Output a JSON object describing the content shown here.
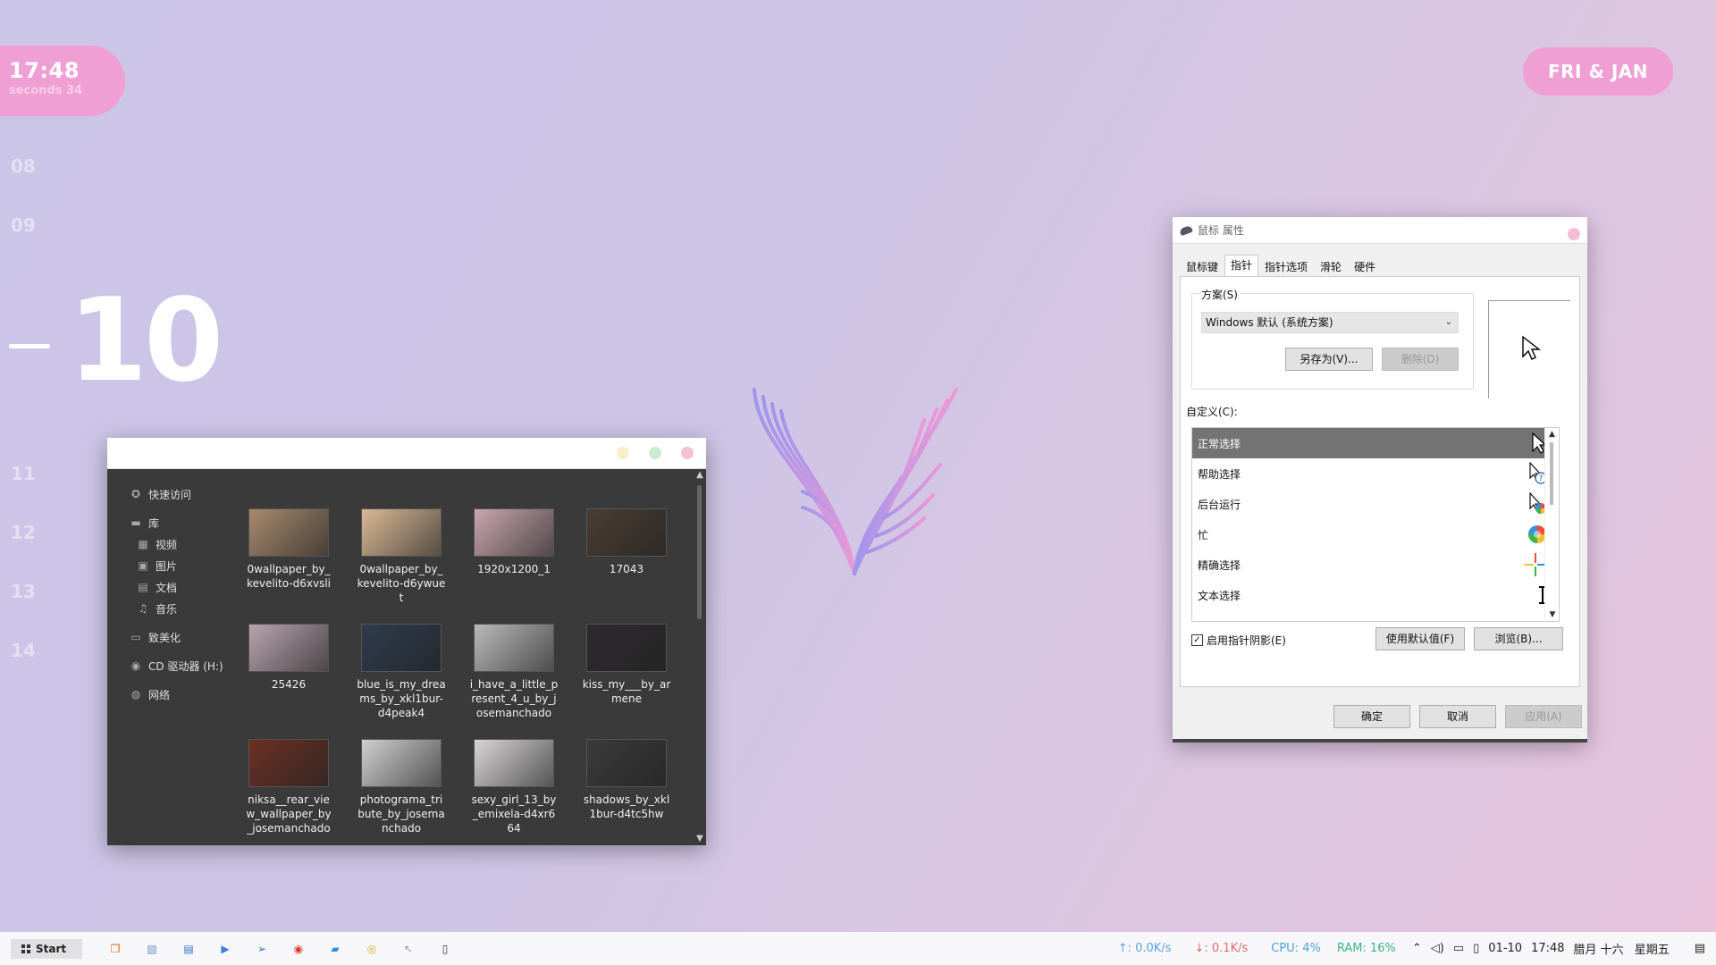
{
  "clock": {
    "time": "17:48",
    "seconds": "seconds 34"
  },
  "date": {
    "label": "FRI & JAN"
  },
  "hours": {
    "h08": "08",
    "h09": "09",
    "current": "10",
    "h11": "11",
    "h12": "12",
    "h13": "13",
    "h14": "14"
  },
  "explorer": {
    "nav": {
      "quick_access": "快速访问",
      "library": "库",
      "videos": "视频",
      "pictures": "图片",
      "documents": "文档",
      "music": "音乐",
      "beautify": "致美化",
      "cd_drive": "CD 驱动器 (H:)",
      "network": "网络"
    },
    "files": [
      {
        "name": "0wallpaper_by_kevelito-d6xvsli",
        "color": "#a88a6e"
      },
      {
        "name": "0wallpaper_by_kevelito-d6ywuet",
        "color": "#d9b996"
      },
      {
        "name": "1920x1200_1",
        "color": "#c9a6ad"
      },
      {
        "name": "17043",
        "color": "#4a3d33"
      },
      {
        "name": "25426",
        "color": "#b7a4ad"
      },
      {
        "name": "blue_is_my_dreams_by_xkl1bur-d4peak4",
        "color": "#2e3b4d"
      },
      {
        "name": "i_have_a_little_present_4_u_by_josemanchado",
        "color": "#b9b9b9"
      },
      {
        "name": "kiss_my___by_armene",
        "color": "#2d2a2d"
      },
      {
        "name": "niksa__rear_view_wallpaper_by_josemanchado",
        "color": "#6a3024"
      },
      {
        "name": "photograma_tribute_by_josemanchado",
        "color": "#cfcfcf"
      },
      {
        "name": "sexy_girl_13_by_emixela-d4xr664",
        "color": "#d8d5d7"
      },
      {
        "name": "shadows_by_xkl1bur-d4tc5hw",
        "color": "#3a3a3a"
      }
    ]
  },
  "dialog": {
    "title": "鼠标 属性",
    "tabs": [
      "鼠标键",
      "指针",
      "指针选项",
      "滑轮",
      "硬件"
    ],
    "active_tab": "指针",
    "scheme_label": "方案(S)",
    "scheme_value": "Windows 默认 (系统方案)",
    "save_as": "另存为(V)...",
    "delete": "删除(D)",
    "customize_label": "自定义(C):",
    "cursors": [
      {
        "label": "正常选择",
        "icon": "arrow-cursor-icon",
        "glyph": "➤"
      },
      {
        "label": "帮助选择",
        "icon": "help-cursor-icon",
        "glyph": "?"
      },
      {
        "label": "后台运行",
        "icon": "working-cursor-icon",
        "glyph": "◔"
      },
      {
        "label": "忙",
        "icon": "busy-cursor-icon",
        "glyph": "●"
      },
      {
        "label": "精确选择",
        "icon": "crosshair-cursor-icon",
        "glyph": "+"
      },
      {
        "label": "文本选择",
        "icon": "text-cursor-icon",
        "glyph": "I"
      }
    ],
    "shadow_checkbox": "启用指针阴影(E)",
    "use_default": "使用默认值(F)",
    "browse": "浏览(B)...",
    "ok": "确定",
    "cancel": "取消",
    "apply": "应用(A)"
  },
  "taskbar": {
    "start": "Start",
    "upload": "↑: 0.0K/s",
    "download": "↓: 0.1K/s",
    "cpu": "CPU: 4%",
    "ram": "RAM: 16%",
    "date": "01-10",
    "time": "17:48",
    "lunar": "腊月 十六",
    "weekday": "星期五"
  },
  "colors": {
    "accent_pink": "#ef9fd4",
    "upload_color": "#5aa4e0",
    "download_color": "#e06a6a",
    "cpu_color": "#4aa3df",
    "ram_color": "#3bb58a"
  }
}
